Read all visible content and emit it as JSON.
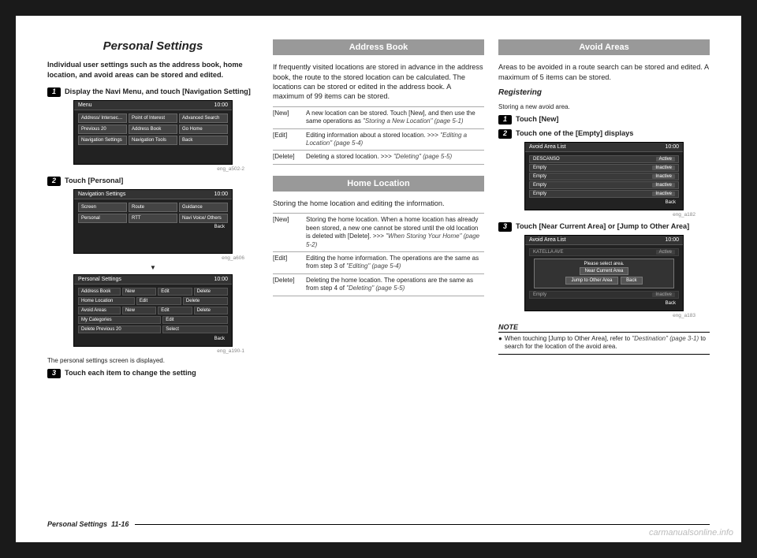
{
  "col1": {
    "title": "Personal Settings",
    "intro": "Individual user settings such as the address book, home location, and avoid areas can be stored and edited.",
    "step1": {
      "n": "1",
      "t": "Display the Navi Menu, and touch [Navigation Setting]"
    },
    "fig1": {
      "bar_l": "Menu",
      "bar_r": "10:00",
      "b1": "Address/ Intersection",
      "b2": "Point of Interest",
      "b3": "Advanced Search",
      "b4": "Previous 20",
      "b5": "Address Book",
      "b6": "Go Home",
      "b7": "Navigation Settings",
      "b8": "Navigation Tools",
      "b9": "Back",
      "cap": "eng_a502-2"
    },
    "step2": {
      "n": "2",
      "t": "Touch [Personal]"
    },
    "fig2": {
      "bar_l": "Navigation Settings",
      "bar_r": "10:00",
      "b1": "Screen",
      "b2": "Route",
      "b3": "Guidance",
      "b4": "Personal",
      "b5": "RTT",
      "b6": "Navi Voice/ Others",
      "bk": "Back",
      "cap": "eng_a606"
    },
    "arrow": "▼",
    "fig3": {
      "bar_l": "Personal Settings",
      "bar_r": "10:00",
      "r1": {
        "a": "Address Book",
        "b": "New",
        "c": "Edit",
        "d": "Delete"
      },
      "r2": {
        "a": "Home Location",
        "b": "",
        "c": "Edit",
        "d": "Delete"
      },
      "r3": {
        "a": "Avoid Areas",
        "b": "New",
        "c": "Edit",
        "d": "Delete"
      },
      "r4": {
        "a": "My Categories",
        "b": "",
        "c": "",
        "d": "Edit"
      },
      "r5": {
        "a": "Delete Previous 20",
        "b": "",
        "c": "",
        "d": "Select"
      },
      "bk": "Back",
      "cap": "eng_a190-1"
    },
    "caption3": "The personal settings screen is displayed.",
    "step3": {
      "n": "3",
      "t": "Touch each item to change the setting"
    }
  },
  "col2": {
    "sec1": {
      "h": "Address Book",
      "t": "If frequently visited locations are stored in advance in the address book, the route to the stored location can be calculated. The locations can be stored or edited in the address book. A maximum of 99 items can be stored."
    },
    "tbl1": [
      {
        "k": "[New]",
        "v": "A new location can be stored. Touch [New], and then use the same operations as ",
        "ref": "\"Storing a New Location\" (page 5-1)"
      },
      {
        "k": "[Edit]",
        "v": "Editing information about a stored location. >>> ",
        "ref": "\"Editing a Location\" (page 5-4)"
      },
      {
        "k": "[Delete]",
        "v": "Deleting a stored location.\n>>> ",
        "ref": "\"Deleting\" (page 5-5)"
      }
    ],
    "sec2": {
      "h": "Home Location",
      "t": "Storing the home location and editing the information."
    },
    "tbl2": [
      {
        "k": "[New]",
        "v": "Storing the home location. When a home location has already been stored, a new one cannot be stored until the old location is deleted with [Delete].\n>>> ",
        "ref": "\"When Storing Your Home\" (page 5-2)"
      },
      {
        "k": "[Edit]",
        "v": "Editing the home information. The operations are the same as from step 3 of ",
        "ref": "\"Editing\" (page 5-4)"
      },
      {
        "k": "[Delete]",
        "v": "Deleting the home location. The operations are the same as from step 4 of ",
        "ref": "\"Deleting\" (page 5-5)"
      }
    ]
  },
  "col3": {
    "sec": {
      "h": "Avoid Areas",
      "t": "Areas to be avoided in a route search can be stored and edited. A maximum of 5 items can be stored."
    },
    "sub": {
      "h": "Registering",
      "t": "Storing a new avoid area."
    },
    "step1": {
      "n": "1",
      "t": "Touch [New]"
    },
    "step2": {
      "n": "2",
      "t": "Touch one of the [Empty] displays"
    },
    "fig1": {
      "bar_l": "Avoid Area List",
      "bar_r": "10:00",
      "rows": [
        {
          "a": "DESCANSO",
          "b": "Active"
        },
        {
          "a": "Empty",
          "b": "Inactive"
        },
        {
          "a": "Empty",
          "b": "Inactive"
        },
        {
          "a": "Empty",
          "b": "Inactive"
        },
        {
          "a": "Empty",
          "b": "Inactive"
        }
      ],
      "bk": "Back",
      "cap": "eng_a182"
    },
    "step3": {
      "n": "3",
      "t": "Touch [Near Current Area] or [Jump to Other Area]"
    },
    "fig2": {
      "bar_l": "Avoid Area List",
      "bar_r": "10:00",
      "row0": {
        "a": "KATELLA AVE",
        "b": "Active"
      },
      "p_title": "Please select area.",
      "p1": "Near Current Area",
      "p2": "Jump to Other Area",
      "p3": "Back",
      "row_last": {
        "a": "Empty",
        "b": "Inactive"
      },
      "bk": "Back",
      "cap": "eng_a183"
    },
    "note": {
      "h": "NOTE",
      "bullet": "●",
      "t1": "When touching [Jump to Other Area], refer to ",
      "ref": "\"Destination\" (page 3-1)",
      "t2": " to search for the location of the avoid area."
    }
  },
  "footer": {
    "title": "Personal Settings",
    "page": "11-16"
  },
  "watermark": "carmanualsonline.info"
}
